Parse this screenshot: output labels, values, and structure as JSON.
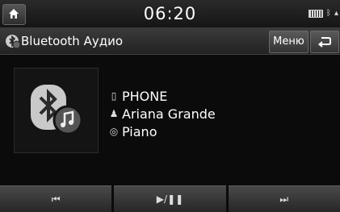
{
  "status": {
    "time": "06:20"
  },
  "header": {
    "title": "Bluetooth Аудио",
    "menu_label": "Меню"
  },
  "track": {
    "device": "PHONE",
    "artist": "Ariana Grande",
    "title": "Piano"
  },
  "controls": {
    "prev_label": "⏮",
    "play_pause_label": "▶/❚❚",
    "next_label": "⏭"
  },
  "icons": {
    "home": "home-icon",
    "bluetooth": "bluetooth-icon",
    "battery": "battery-icon",
    "back": "back-icon",
    "music_note": "music-note-icon",
    "phone": "phone-icon",
    "person": "person-icon",
    "disc": "disc-icon"
  }
}
